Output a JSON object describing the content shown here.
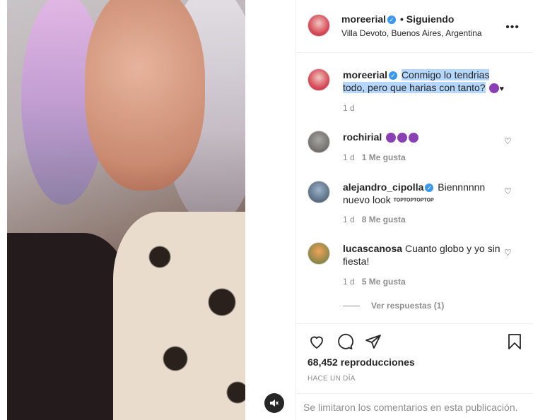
{
  "post": {
    "author": "moreerial",
    "follow_label": "• Siguiendo",
    "location": "Villa Devoto, Buenos Aires, Argentina",
    "more_icon": "more-options-icon"
  },
  "caption": {
    "author": "moreerial",
    "text": "Conmigo lo tendrias todo, pero que harias con tanto?",
    "time": "1 d"
  },
  "comments": [
    {
      "author": "rochirial",
      "text": "",
      "time": "1 d",
      "likes": "1 Me gusta"
    },
    {
      "author": "alejandro_cipolla",
      "text": "Biennnnnn nuevo look",
      "suffix": "TOPTOPTOPTOP",
      "time": "1 d",
      "likes": "8 Me gusta"
    },
    {
      "author": "lucascanosa",
      "text": "Cuanto globo y yo sin fiesta!",
      "time": "1 d",
      "likes": "5 Me gusta"
    }
  ],
  "replies_label": "Ver respuestas (1)",
  "stats": {
    "views": "68,452 reproducciones",
    "ago": "HACE UN DÍA"
  },
  "comments_limited": "Se limitaron los comentarios en esta publicación.",
  "colors": {
    "verified": "#3897f0",
    "highlight": "#b4d7fb",
    "muted": "#8e8e8e"
  }
}
